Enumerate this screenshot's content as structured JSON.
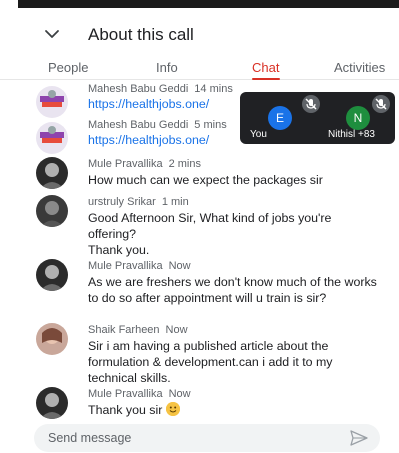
{
  "header": {
    "title": "About this call"
  },
  "tabs": [
    {
      "label": "People"
    },
    {
      "label": "Info"
    },
    {
      "label": "Chat"
    },
    {
      "label": "Activities"
    }
  ],
  "messages": [
    {
      "name": "Mahesh Babu Geddi",
      "time": "14 mins",
      "text": "https://healthjobs.one/",
      "is_link": true
    },
    {
      "name": "Mahesh Babu Geddi",
      "time": "5 mins",
      "text": "https://healthjobs.one/",
      "is_link": true
    },
    {
      "name": "Mule Pravallika",
      "time": "2 mins",
      "text": "How much can we expect the packages sir",
      "is_link": false
    },
    {
      "name": "urstruly Srikar",
      "time": "1 min",
      "text": "Good Afternoon Sir, What kind of jobs you're offering?\nThank you.",
      "is_link": false
    },
    {
      "name": "Mule Pravallika",
      "time": "Now",
      "text": "As we are freshers we don't know much of the works to do so after appointment will u train is sir?",
      "is_link": false
    },
    {
      "name": "Shaik Farheen",
      "time": "Now",
      "text": "Sir i am having a published article about the formulation & development.can i add it to my technical skills.",
      "is_link": false
    },
    {
      "name": "Mule Pravallika",
      "time": "Now",
      "text": "Thank you sir",
      "is_link": false
    }
  ],
  "video_overlay": {
    "tiles": [
      {
        "initial": "E",
        "label": "You",
        "color": "#1a73e8"
      },
      {
        "initial": "N",
        "label": "Nithisl +83",
        "color": "#1e8e3e"
      }
    ]
  },
  "composer": {
    "placeholder": "Send message"
  },
  "colors": {
    "accent": "#d93025",
    "link": "#1a73e8"
  },
  "icons": {
    "back": "chevron-down-icon",
    "send": "send-icon",
    "mic_off": "mic-off-icon",
    "emoji": "smiling-face-emoji"
  }
}
